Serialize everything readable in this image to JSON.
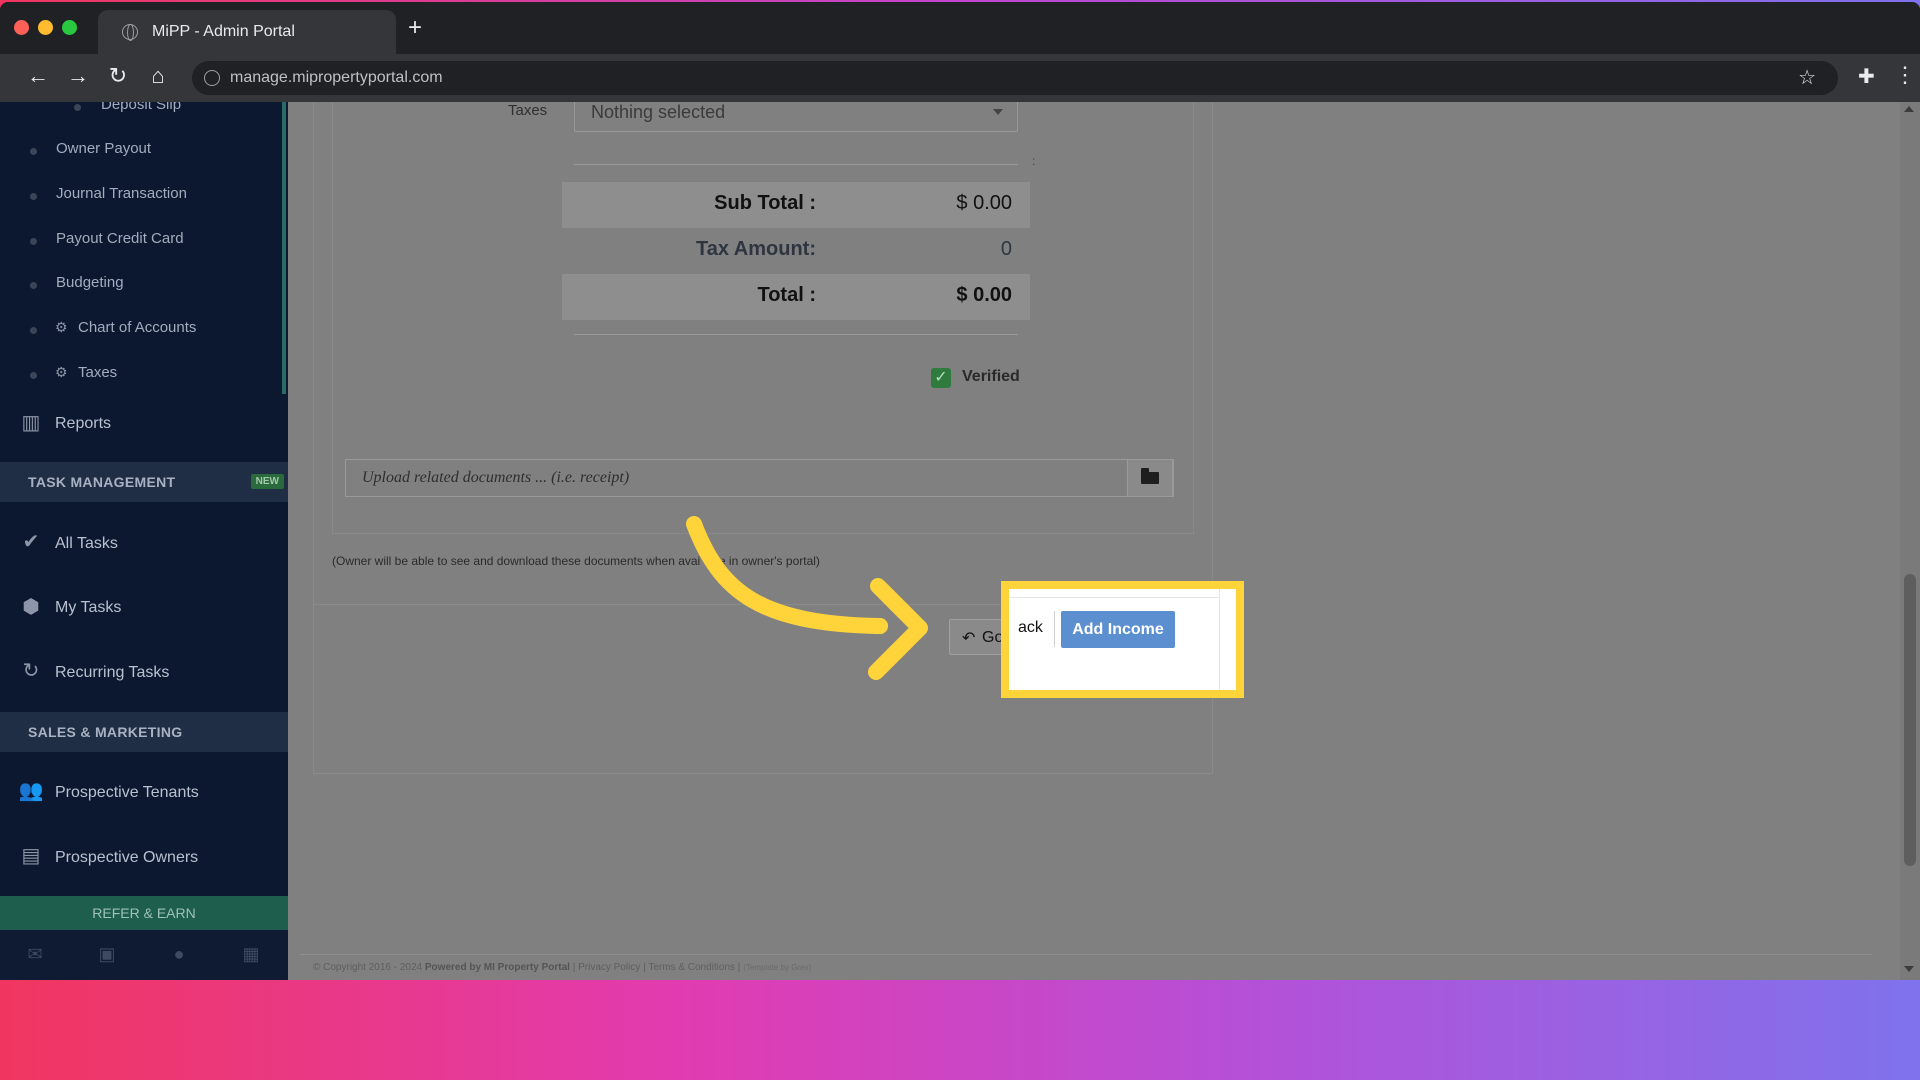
{
  "browser": {
    "tab_title": "MiPP - Admin Portal",
    "url": "manage.mipropertyportal.com"
  },
  "sidebar": {
    "sub_items": [
      "Deposit Slip",
      "Owner Payout",
      "Journal Transaction",
      "Payout Credit Card",
      "Budgeting",
      "Chart of Accounts",
      "Taxes"
    ],
    "reports": "Reports",
    "task_management": {
      "label": "TASK MANAGEMENT",
      "badge": "NEW"
    },
    "tasks": [
      "All Tasks",
      "My Tasks",
      "Recurring Tasks"
    ],
    "sales_marketing": "SALES & MARKETING",
    "marketing": [
      "Prospective Tenants",
      "Prospective Owners"
    ],
    "refer": "REFER & EARN"
  },
  "form": {
    "taxes_label": "Taxes",
    "taxes_placeholder": "Nothing selected",
    "colon": ":",
    "subtotal_label": "Sub Total :",
    "subtotal_value": "$ 0.00",
    "tax_amount_label": "Tax Amount:",
    "tax_amount_value": "0",
    "total_label": "Total :",
    "total_value": "$ 0.00",
    "verified_label": "Verified",
    "upload_placeholder": "Upload related documents ... (i.e. receipt)",
    "note": "(Owner will be able to see and download these documents when available in owner's portal)",
    "go_back_label": "Go Back",
    "go_back_partial_a": "Go",
    "go_back_partial_b": "ack",
    "add_income_label": "Add Income"
  },
  "footer": {
    "copyright": "© Copyright 2016 - 2024",
    "powered": "Powered by MI Property Portal",
    "privacy": "Privacy Policy",
    "terms": "Terms & Conditions",
    "template": "(Template by Grex)"
  },
  "colors": {
    "highlight": "#ffd43a",
    "add_income": "#5b8fd0",
    "sidebar": "#0b1830",
    "verified": "#2f7a3d"
  }
}
